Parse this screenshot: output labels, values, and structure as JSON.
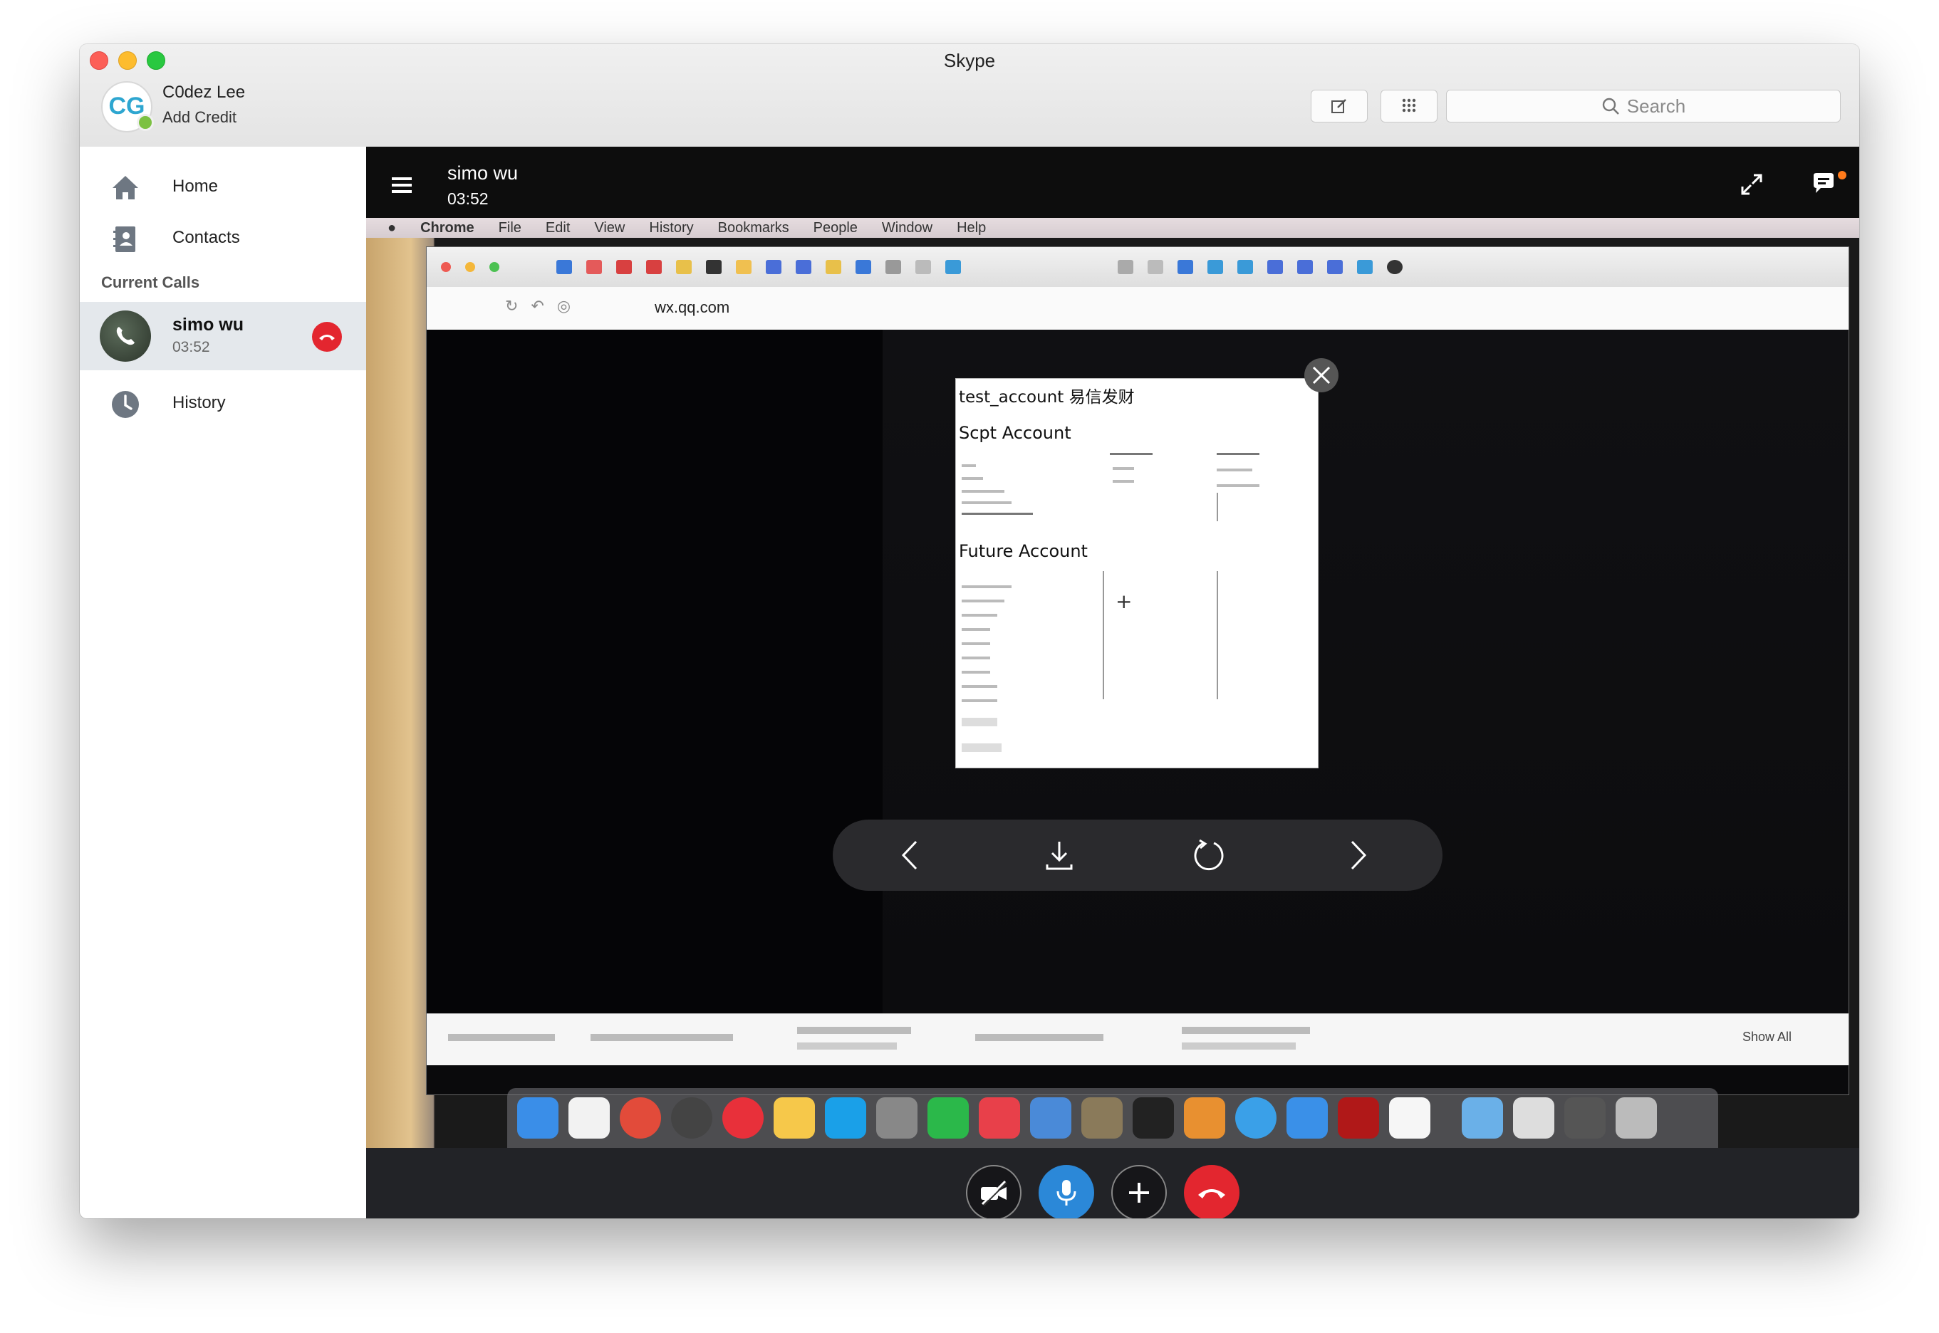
{
  "window": {
    "title": "Skype"
  },
  "profile": {
    "name": "C0dez Lee",
    "sub": "Add Credit",
    "avatar_text": "CG"
  },
  "toolbar": {
    "search_placeholder": "Search"
  },
  "sidebar": {
    "nav": [
      {
        "label": "Home",
        "icon": "home-icon"
      },
      {
        "label": "Contacts",
        "icon": "contacts-icon"
      }
    ],
    "section_current_calls": "Current Calls",
    "current_call": {
      "name": "simo wu",
      "duration": "03:52"
    },
    "history": {
      "label": "History",
      "icon": "clock-icon"
    }
  },
  "call": {
    "header": {
      "name": "simo wu",
      "duration": "03:52"
    },
    "shared_screen": {
      "menubar": [
        "Chrome",
        "File",
        "Edit",
        "View",
        "History",
        "Bookmarks",
        "People",
        "Window",
        "Help"
      ],
      "address": "wx.qq.com",
      "preview": {
        "title": "test_account 易信发财",
        "section1": "Scpt Account",
        "section2": "Future Account"
      },
      "downloads_show_all": "Show All"
    },
    "colors": {
      "accent": "#2b88d8",
      "hangup": "#e3262f",
      "header_bg": "#0d0d0d"
    }
  }
}
